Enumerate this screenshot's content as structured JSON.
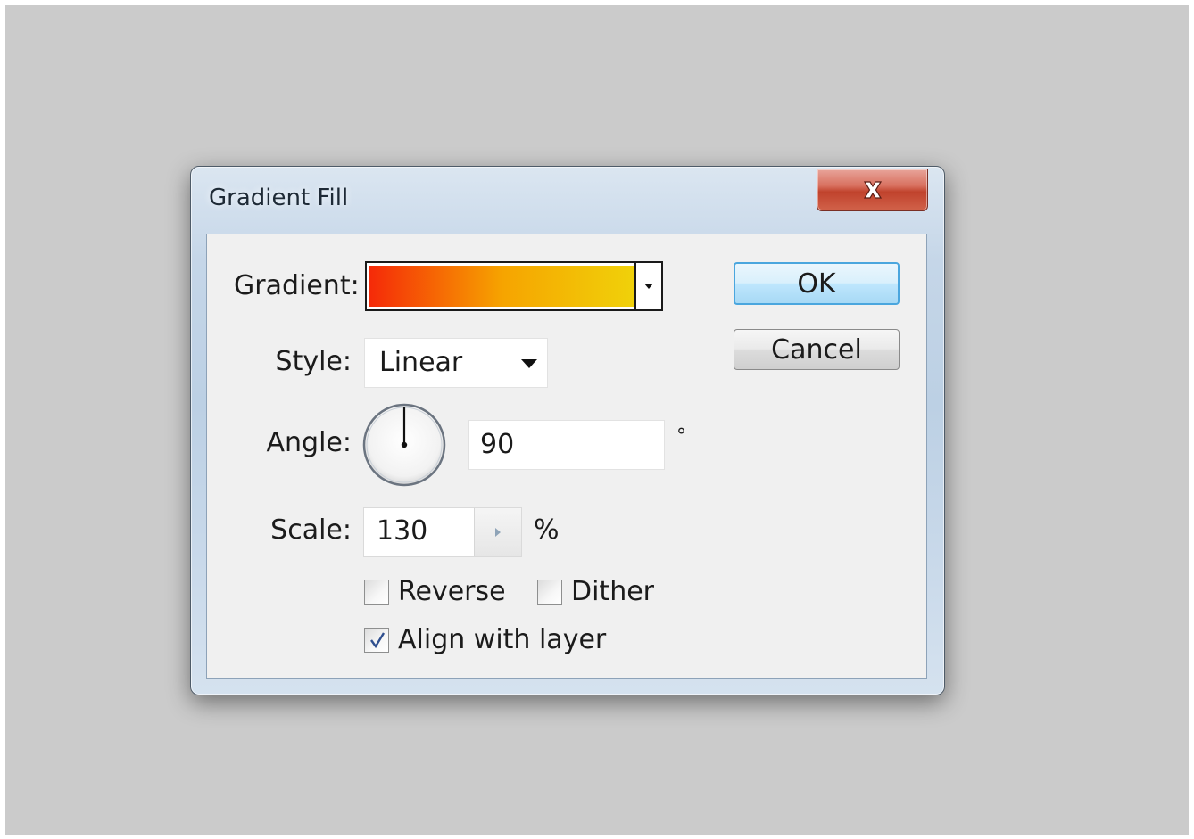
{
  "window": {
    "title": "Gradient Fill"
  },
  "gradient": {
    "label": "Gradient:",
    "colors": [
      "#f52a08",
      "#f6a400",
      "#f0d20a"
    ]
  },
  "style": {
    "label": "Style:",
    "value": "Linear"
  },
  "angle": {
    "label": "Angle:",
    "value": "90",
    "unit": "°",
    "degrees": 90
  },
  "scale": {
    "label": "Scale:",
    "value": "130",
    "unit": "%"
  },
  "options": {
    "reverse": {
      "label": "Reverse",
      "checked": false
    },
    "dither": {
      "label": "Dither",
      "checked": false
    },
    "align": {
      "label": "Align with layer",
      "checked": true
    }
  },
  "buttons": {
    "ok": "OK",
    "cancel": "Cancel"
  },
  "icons": {
    "close": "close-icon",
    "dropdown": "chevron-down-icon",
    "stepper": "triangle-right-icon",
    "check": "checkmark-icon"
  }
}
